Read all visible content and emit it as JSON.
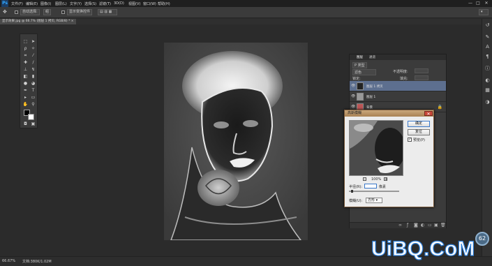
{
  "app": {
    "logo": "Ps"
  },
  "menu": [
    "文件(F)",
    "编辑(E)",
    "图像(I)",
    "图层(L)",
    "文字(Y)",
    "选择(S)",
    "滤镜(T)",
    "3D(D)",
    "视图(V)",
    "窗口(W)",
    "帮助(H)"
  ],
  "window_controls": {
    "minimize": "—",
    "maximize": "□",
    "close": "✕"
  },
  "options_bar": {
    "auto_select_label": "自动选择:",
    "auto_select_value": "组",
    "transform_label": "显示变换控件"
  },
  "document_tab": {
    "title": "显示效果.jpg @ 66.7% (图层 1 拷贝, RGB/8) *",
    "close": "×"
  },
  "layers_panel": {
    "tabs": [
      "图层",
      "通道"
    ],
    "kind_filter": "P 类型",
    "blend_mode": "滤色",
    "opacity_label": "不透明度:",
    "lock_label": "锁定:",
    "fill_label": "填充:",
    "layers": [
      {
        "name": "图层 1 拷贝",
        "selected": true
      },
      {
        "name": "图层 1",
        "selected": false
      },
      {
        "name": "背景",
        "selected": false
      }
    ]
  },
  "dialog": {
    "title": "高斯模糊",
    "ok": "确定",
    "reset": "复位",
    "preview_label": "预览(P)",
    "preview_checked": true,
    "zoom_value": "100%",
    "radius_label": "半径(R):",
    "radius_unit": "像素",
    "mode_label": "模糊(U):",
    "mode_value": "方形"
  },
  "status_bar": {
    "zoom": "66.67%",
    "doc_info": "文档:380K/1.02M"
  },
  "watermark": "UiBQ.CoM",
  "perf_indicator": "62",
  "colors": {
    "accent": "#2f7fd8",
    "selected_layer": "#5d6f8f",
    "dialog_title": "#b48c5c"
  }
}
